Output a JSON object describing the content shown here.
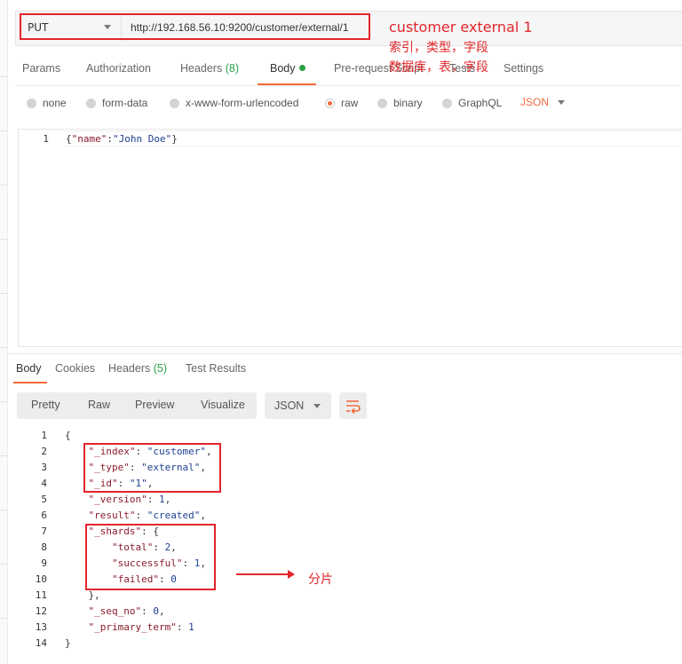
{
  "request": {
    "method": "PUT",
    "url": "http://192.168.56.10:9200/customer/external/1",
    "tabs": [
      {
        "label": "Params"
      },
      {
        "label": "Authorization"
      },
      {
        "label": "Headers",
        "count": "(8)"
      },
      {
        "label": "Body"
      },
      {
        "label": "Pre-request Script"
      },
      {
        "label": "Tests"
      },
      {
        "label": "Settings"
      }
    ],
    "body_types": [
      "none",
      "form-data",
      "x-www-form-urlencoded",
      "raw",
      "binary",
      "GraphQL"
    ],
    "selected_body_type": "raw",
    "format": "JSON",
    "editor_line_number": "1",
    "editor_content": "{\"name\":\"John Doe\"}"
  },
  "response": {
    "tabs": [
      {
        "label": "Body"
      },
      {
        "label": "Cookies"
      },
      {
        "label": "Headers",
        "count": "(5)"
      },
      {
        "label": "Test Results"
      }
    ],
    "view_modes": [
      "Pretty",
      "Raw",
      "Preview",
      "Visualize"
    ],
    "format": "JSON",
    "lines": [
      {
        "n": "1",
        "text": "{"
      },
      {
        "n": "2",
        "text": "    \"_index\": \"customer\","
      },
      {
        "n": "3",
        "text": "    \"_type\": \"external\","
      },
      {
        "n": "4",
        "text": "    \"_id\": \"1\","
      },
      {
        "n": "5",
        "text": "    \"_version\": 1,"
      },
      {
        "n": "6",
        "text": "    \"result\": \"created\","
      },
      {
        "n": "7",
        "text": "    \"_shards\": {"
      },
      {
        "n": "8",
        "text": "        \"total\": 2,"
      },
      {
        "n": "9",
        "text": "        \"successful\": 1,"
      },
      {
        "n": "10",
        "text": "        \"failed\": 0"
      },
      {
        "n": "11",
        "text": "    },"
      },
      {
        "n": "12",
        "text": "    \"_seq_no\": 0,"
      },
      {
        "n": "13",
        "text": "    \"_primary_term\": 1"
      },
      {
        "n": "14",
        "text": "}"
      }
    ]
  },
  "annotations": {
    "url_note_line1": "customer external 1",
    "url_note_line2": "索引，类型，字段",
    "url_note_line3": "数据库，表，字段",
    "shards_note": "分片"
  },
  "colors": {
    "accent": "#f26b3a",
    "annotation": "#e2262a",
    "badge_green": "#2aa147"
  }
}
